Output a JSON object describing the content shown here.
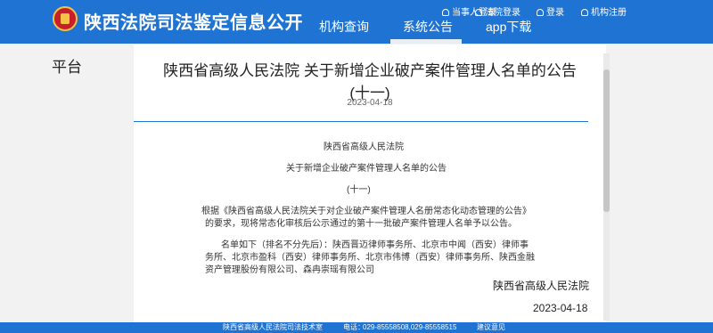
{
  "header": {
    "title": "陕西法院司法鉴定信息公开",
    "top_links": [
      "当事人登录",
      "法院登录",
      "登录",
      "机构注册"
    ],
    "nav": [
      "机构查询",
      "系统公告",
      "app下载"
    ],
    "active_nav": "系统公告"
  },
  "page": {
    "left_partial_text": "平台"
  },
  "announcement": {
    "title_line1": "陕西省高级人民法院 关于新增企业破产案件管理人名单的公告",
    "title_line2": "(十一)",
    "date": "2023-04-18",
    "body": {
      "heading1": "陕西省高级人民法院",
      "heading2": "关于新增企业破产案件管理人名单的公告",
      "heading3": "(十一)",
      "para1_line1": "根据《陕西省高级人民法院关于对企业破产案件管理人名册常态化动态管理的公告》",
      "para1_line2": "的要求，现将常态化审核后公示通过的第十一批破产案件管理人名单予以公告。",
      "para2_line1": "名单如下（排名不分先后）：陕西晋迈律师事务所、北京市中闻（西安）律师事",
      "para2_line2": "务所、北京市盈科（西安）律师事务所、北京市伟博（西安）律师事务所、陕西金融",
      "para2_line3": "资产管理股份有限公司、森冉崇瑶有限公司"
    },
    "signature_court": "陕西省高级人民法院",
    "signature_date": "2023-04-18"
  },
  "footer": {
    "org": "陕西省高级人民法院司法技术室",
    "phone_label": "电话：",
    "phone": "029-85558508,029-85558515",
    "feedback": "建议意见"
  },
  "colors": {
    "header_blue": "#1f73d2",
    "page_bg": "#f2f2f2"
  }
}
